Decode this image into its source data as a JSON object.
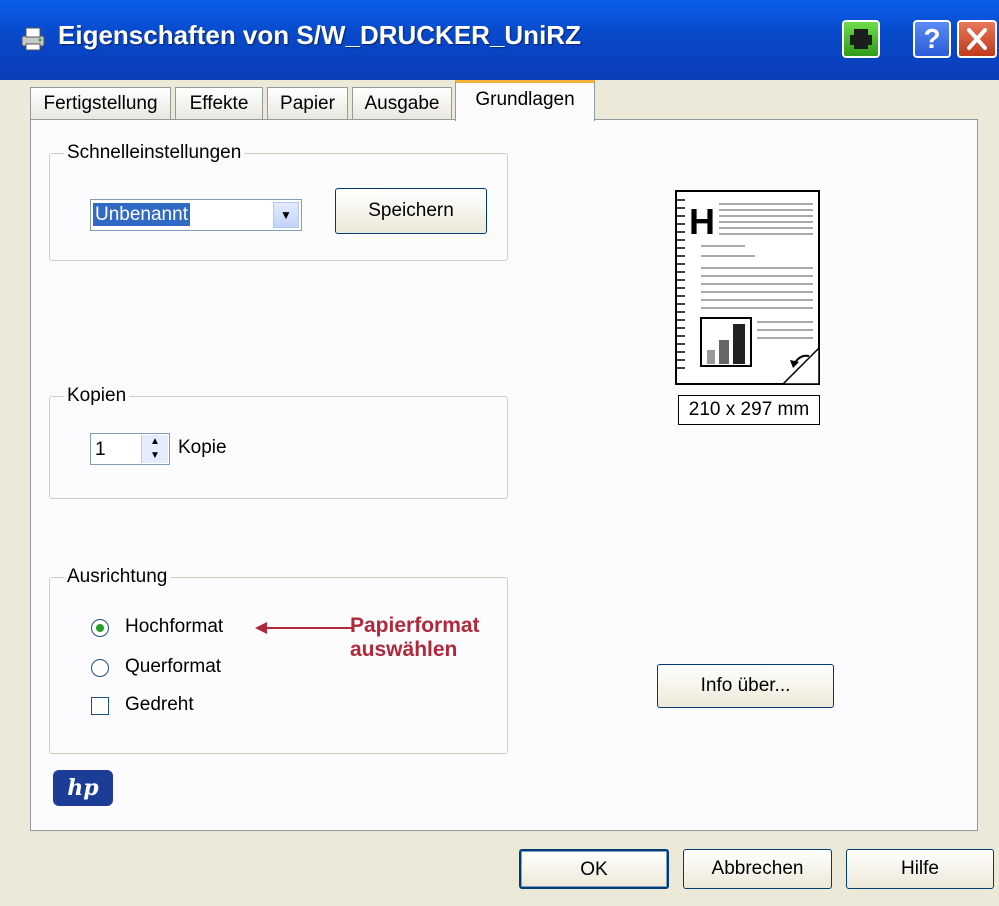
{
  "window": {
    "title": "Eigenschaften von S/W_DRUCKER_UniRZ",
    "help_label": "?"
  },
  "tabs": [
    {
      "label": "Fertigstellung"
    },
    {
      "label": "Effekte"
    },
    {
      "label": "Papier"
    },
    {
      "label": "Ausgabe"
    },
    {
      "label": "Grundlagen",
      "active": true
    }
  ],
  "schnelleinstellungen": {
    "legend": "Schnelleinstellungen",
    "selected": "Unbenannt",
    "save_label": "Speichern"
  },
  "kopien": {
    "legend": "Kopien",
    "value": "1",
    "unit_label": "Kopie"
  },
  "ausrichtung": {
    "legend": "Ausrichtung",
    "options": [
      {
        "label": "Hochformat",
        "checked": true
      },
      {
        "label": "Querformat",
        "checked": false
      }
    ],
    "rotated_label": "Gedreht",
    "rotated_checked": false
  },
  "annotation": {
    "line1": "Papierformat",
    "line2": "auswählen",
    "color": "#b0293a"
  },
  "preview": {
    "size_label": "210 x 297 mm"
  },
  "info_button": "Info über...",
  "logo_text": "hp",
  "footer": {
    "ok": "OK",
    "cancel": "Abbrechen",
    "help": "Hilfe"
  },
  "colors": {
    "titlebar": "#0848c9",
    "window_bg": "#ece9d8",
    "selection": "#316ac5",
    "active_tab_accent": "#f5b13a"
  }
}
